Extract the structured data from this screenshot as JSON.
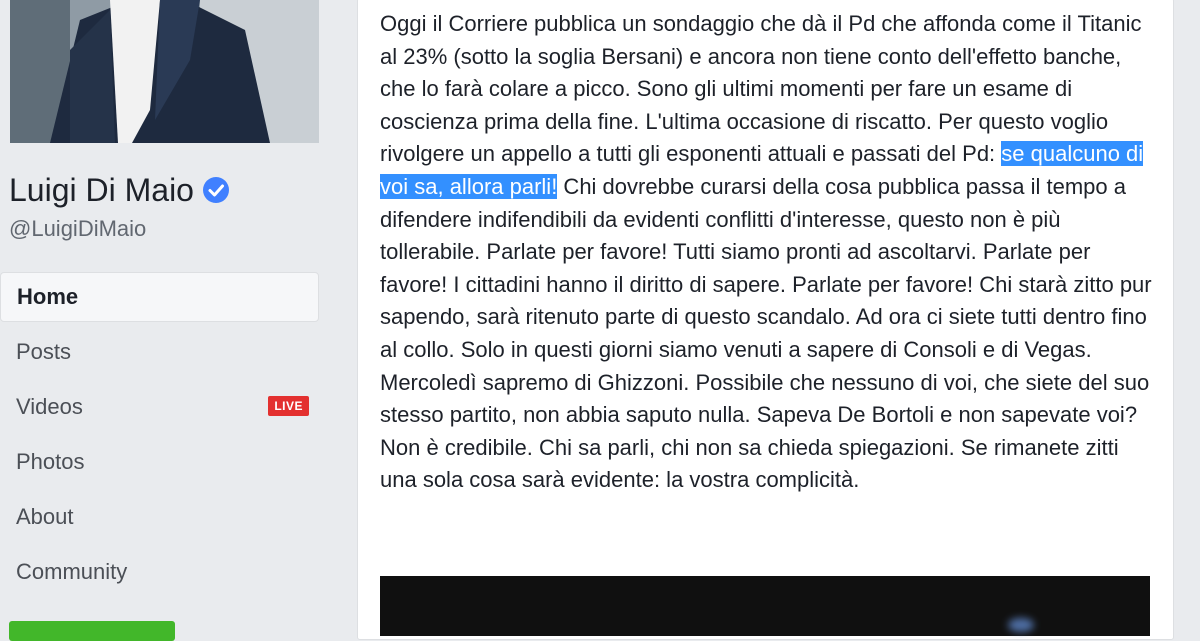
{
  "profile": {
    "name": "Luigi Di Maio",
    "handle": "@LuigiDiMaio",
    "verified_color": "#4080ff"
  },
  "nav": {
    "items": [
      {
        "label": "Home"
      },
      {
        "label": "Posts"
      },
      {
        "label": "Videos",
        "badge": "LIVE"
      },
      {
        "label": "Photos"
      },
      {
        "label": "About"
      },
      {
        "label": "Community"
      }
    ]
  },
  "post": {
    "text_before": "Oggi il Corriere pubblica un sondaggio che dà il Pd che affonda come il Titanic al 23% (sotto la soglia Bersani) e ancora non tiene conto dell'effetto banche, che lo farà colare a picco. Sono gli ultimi momenti per fare un esame di coscienza prima della fine. L'ultima occasione di riscatto. Per questo voglio rivolgere un appello a tutti gli esponenti attuali e passati del Pd: ",
    "highlighted": "se qualcuno di voi sa, allora parli!",
    "text_after": " Chi dovrebbe curarsi della cosa pubblica passa il tempo a difendere indifendibili da evidenti conflitti d'interesse, questo non è più tollerabile. Parlate per favore! Tutti siamo pronti ad ascoltarvi. Parlate per favore! I cittadini hanno il diritto di sapere. Parlate per favore! Chi starà zitto pur sapendo, sarà ritenuto parte di questo scandalo. Ad ora ci siete tutti dentro fino al collo. Solo in questi giorni siamo venuti a sapere di Consoli e di Vegas. Mercoledì sapremo di Ghizzoni. Possibile che nessuno di voi, che siete del suo stesso partito, non abbia saputo nulla. Sapeva De Bortoli e non sapevate voi? Non è credibile. Chi sa parli, chi non sa chieda spiegazioni. Se rimanete zitti una sola cosa sarà evidente: la vostra complicità."
  },
  "colors": {
    "highlight": "#3390ff",
    "live_badge": "#e3302f",
    "action_button": "#42b72a"
  }
}
